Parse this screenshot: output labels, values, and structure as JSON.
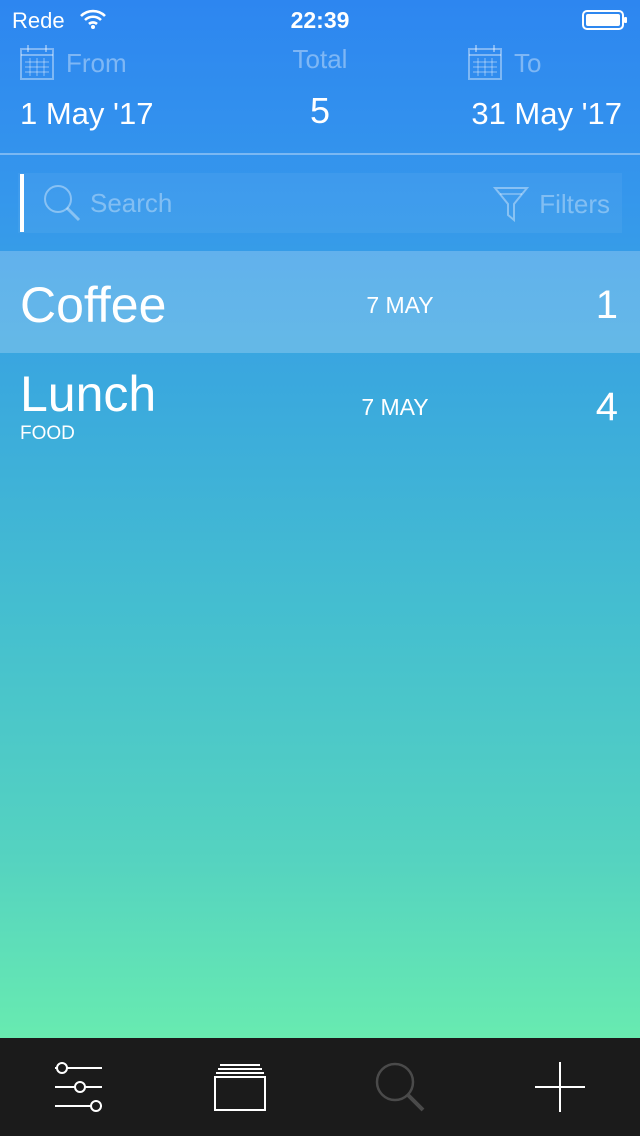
{
  "status_bar": {
    "carrier": "Rede",
    "time": "22:39"
  },
  "header": {
    "from_label": "From",
    "from_value": "1 May '17",
    "total_label": "Total",
    "total_value": "5",
    "to_label": "To",
    "to_value": "31 May '17"
  },
  "search": {
    "placeholder": "Search",
    "filters_label": "Filters"
  },
  "entries": [
    {
      "name": "Coffee",
      "category": "",
      "date": "7 MAY",
      "amount": "1"
    },
    {
      "name": "Lunch",
      "category": "FOOD",
      "date": "7 MAY",
      "amount": "4"
    }
  ],
  "tab_bar": {
    "items": [
      "sliders-icon",
      "cards-icon",
      "search-icon",
      "plus-icon"
    ]
  },
  "colors": {
    "gradient_top": "#2d86f0",
    "gradient_bottom": "#68ebb0",
    "tab_bar": "#1b1b1b"
  }
}
